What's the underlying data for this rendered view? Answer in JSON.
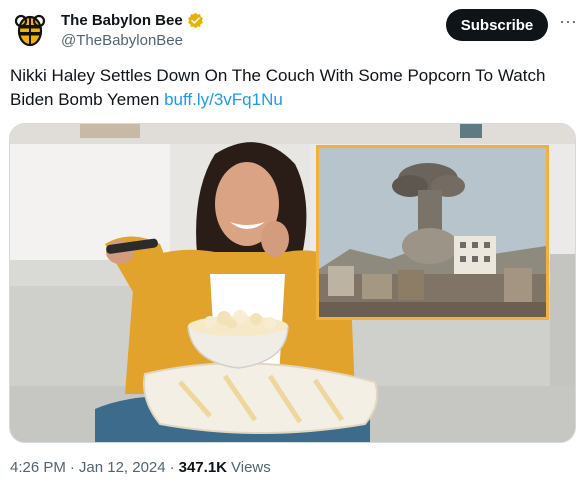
{
  "author": {
    "display_name": "The Babylon Bee",
    "handle": "@TheBabylonBee",
    "verified": true,
    "avatar_icon": "bee-logo-icon",
    "verified_icon": "verified-badge-icon",
    "verified_color": "#e8b100"
  },
  "actions": {
    "subscribe_label": "Subscribe",
    "more_icon": "more-options-icon",
    "more_glyph": "···"
  },
  "tweet": {
    "text": "Nikki Haley Settles Down On The Couch With Some Popcorn To Watch Biden Bomb Yemen ",
    "link": "buff.ly/3vFq1Nu"
  },
  "meta": {
    "time": "4:26 PM",
    "separator": "·",
    "date": "Jan 12, 2024",
    "views_count": "347.1K",
    "views_label": "Views"
  },
  "colors": {
    "link": "#1d9bf0",
    "button_bg": "#0f1419",
    "secondary_text": "#536471",
    "inset_border": "#f2b13c"
  }
}
